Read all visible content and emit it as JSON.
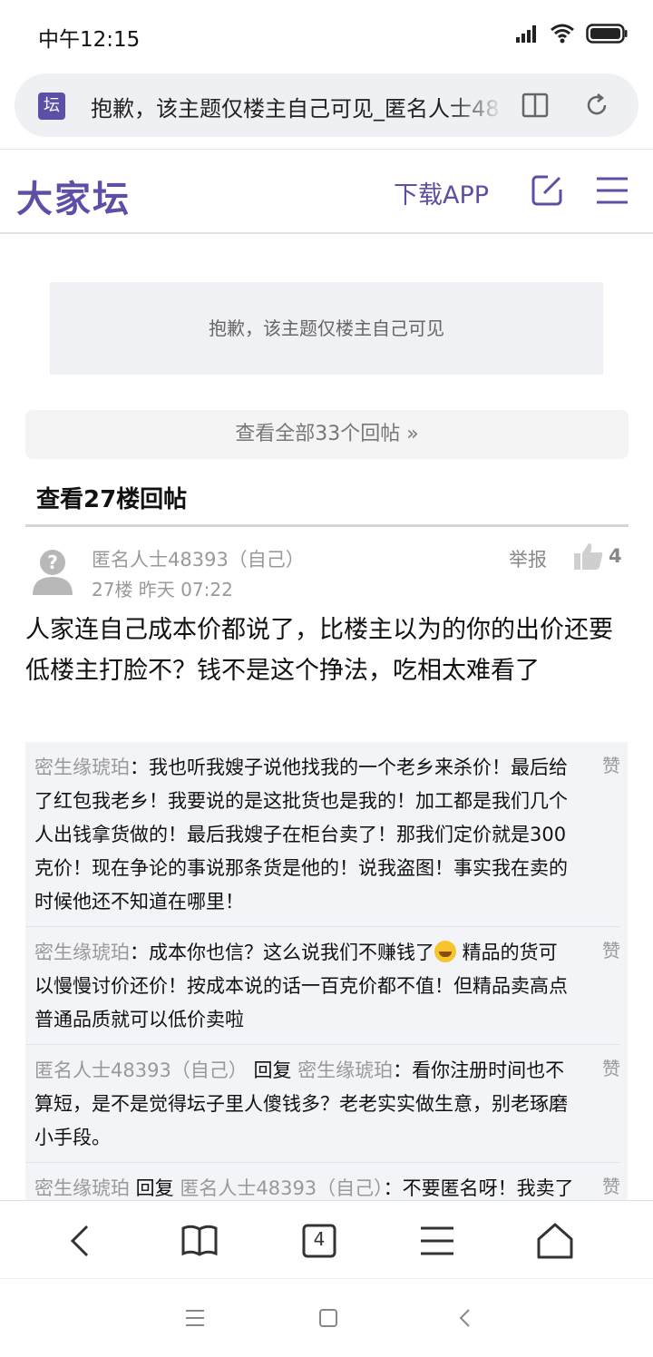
{
  "status_bar": {
    "time": "中午12:15"
  },
  "address_bar": {
    "favicon": "坛",
    "title": "抱歉，该主题仅楼主自己可见_匿名人士48"
  },
  "site": {
    "logo": "大家坛",
    "download_app": "下载APP",
    "brand_color": "#5b4fa6"
  },
  "notice": "抱歉，该主题仅楼主自己可见",
  "view_all": "查看全部33个回帖 »",
  "floor_title": "查看27楼回帖",
  "post": {
    "author": "匿名人士48393（自己）",
    "meta": "27楼  昨天 07:22",
    "report": "举报",
    "likes": "4",
    "body": "人家连自己成本价都说了，比楼主以为的你的出价还要低楼主打脸不？钱不是这个挣法，吃相太难看了"
  },
  "replies": [
    {
      "author": "密生缘琥珀",
      "verb": "",
      "target": "",
      "sep": "：",
      "text": "我也听我嫂子说他找我的一个老乡来杀价！最后给了红包我老乡！我要说的是这批货也是我的！加工都是我们几个人出钱拿货做的！最后我嫂子在柜台卖了！那我们定价就是300克价！现在争论的事说那条货是他的！说我盗图！事实我在卖的时候他还不知道在哪里！",
      "text2": "",
      "like": "赞"
    },
    {
      "author": "密生缘琥珀",
      "verb": "",
      "target": "",
      "sep": "：",
      "text": "成本你也信？这么说我们不赚钱了",
      "text2": " 精品的货可以慢慢讨价还价！按成本说的话一百克价都不值！但精品卖高点普通品质就可以低价卖啦",
      "like": "赞"
    },
    {
      "author": "匿名人士48393（自己）",
      "verb": " 回复 ",
      "target": "密生缘琥珀",
      "sep": "：",
      "text": "看你注册时间也不算短，是不是觉得坛子里人傻钱多？老老实实做生意，别老琢磨小手段。",
      "text2": "",
      "like": "赞"
    },
    {
      "author": "密生缘琥珀",
      "verb": " 回复 ",
      "target": "匿名人士48393（自己）",
      "sep": "：",
      "text": "不要匿名呀！我卖了论坛那么多没有一个拿出来晒说是价高的离谱的！你又不",
      "text2": "",
      "like": "赞"
    }
  ],
  "bottom_bar": {
    "tab_count": "4"
  }
}
